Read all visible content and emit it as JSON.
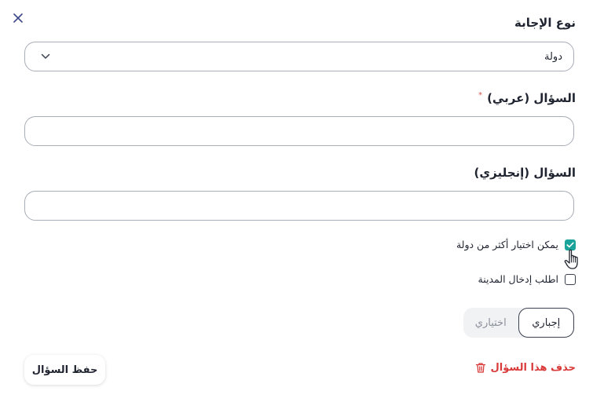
{
  "form": {
    "answer_type_label": "نوع الإجابة",
    "answer_type_value": "دولة",
    "question_ar_label": "السؤال (عربي)",
    "required_mark": "*",
    "question_ar_value": "",
    "question_en_label": "السؤال (إنجليزي)",
    "question_en_value": ""
  },
  "options": {
    "multi_country_label": "يمكن اختيار أكثر من دولة",
    "multi_country_checked": true,
    "require_city_label": "اطلب إدخال المدينة",
    "require_city_checked": false
  },
  "toggle": {
    "required_label": "إجباري",
    "optional_label": "اختياري",
    "selected": "required"
  },
  "actions": {
    "save_label": "حفظ السؤال",
    "delete_label": "حذف هذا السؤال"
  },
  "icons": {
    "close": "close-icon",
    "dropdown": "chevron-down-icon",
    "check": "check-icon",
    "delete": "trash-icon",
    "cursor": "hand-pointer-icon"
  },
  "colors": {
    "accent": "#1aa39a",
    "danger": "#d93a3a",
    "close_icon": "#3d4a8a",
    "border": "#a8adb7"
  }
}
